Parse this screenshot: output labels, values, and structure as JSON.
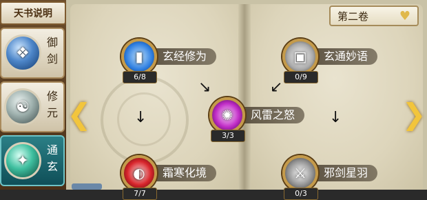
{
  "help_button": "天书说明",
  "sidebar": {
    "items": [
      {
        "label": "御剑",
        "emblem": "sword-emblem-icon"
      },
      {
        "label": "修元",
        "emblem": "cultivate-emblem-icon"
      },
      {
        "label": "通玄",
        "emblem": "mystic-emblem-icon"
      }
    ]
  },
  "volume_selector": {
    "label": "第二卷",
    "icon": "heart-dropdown-icon"
  },
  "nodes": [
    {
      "name": "玄经修为",
      "count": "6/8"
    },
    {
      "name": "玄通妙语",
      "count": "0/9"
    },
    {
      "name": "风雷之怒",
      "count": "3/3"
    },
    {
      "name": "霜寒化境",
      "count": "7/7"
    },
    {
      "name": "邪剑星羽",
      "count": "0/3"
    }
  ],
  "colors": {
    "accent_gold": "#f2c53c",
    "active_tab": "#1f6a72"
  }
}
